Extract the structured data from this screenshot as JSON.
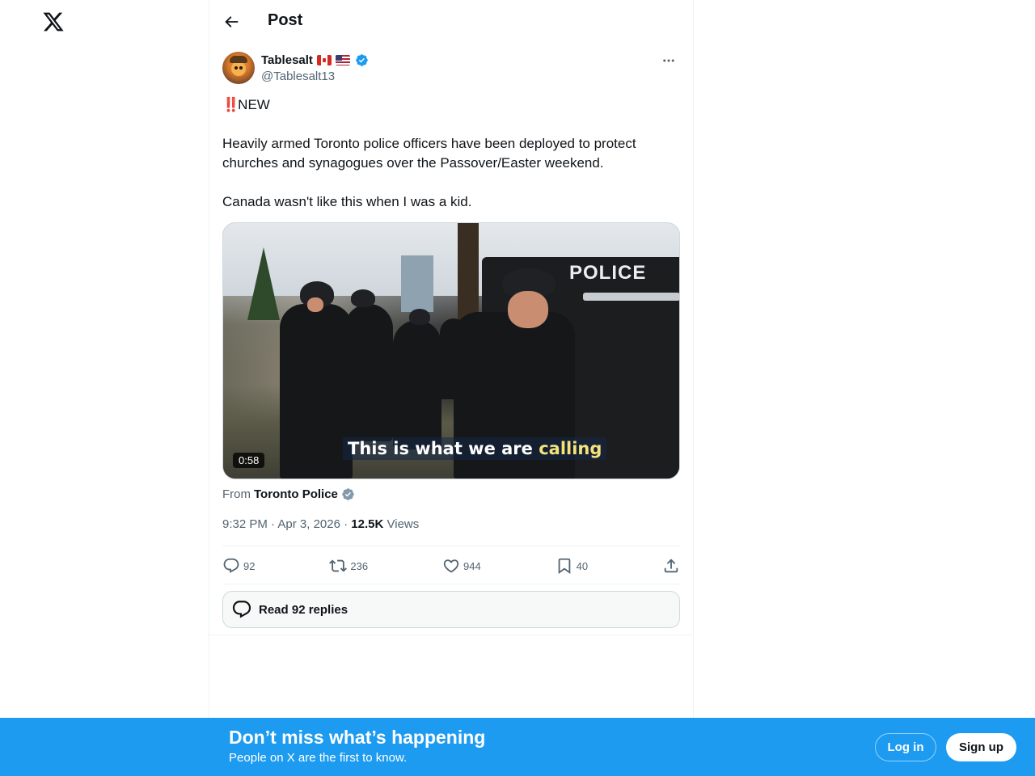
{
  "header": {
    "title": "Post"
  },
  "author": {
    "display_name": "Tablesalt",
    "handle": "@Tablesalt13",
    "flags": [
      "canada-flag-icon",
      "usa-flag-icon"
    ],
    "verified": true
  },
  "tweet": {
    "bang": "‼️",
    "line1": "NEW",
    "body": "Heavily armed Toronto police officers have been deployed to protect churches and synagogues over the Passover/Easter weekend.",
    "closing": "Canada wasn't like this when I was a kid."
  },
  "media": {
    "caption_start": "This is what we are ",
    "caption_highlight": "calling",
    "vehicle_label": "POLICE",
    "duration": "0:58"
  },
  "source": {
    "prefix": "From",
    "name": "Toronto Police"
  },
  "meta": {
    "time": "9:32 PM",
    "separator": "·",
    "date": "Apr 3, 2026",
    "views_count": "12.5K",
    "views_label": "Views"
  },
  "actions": {
    "replies": "92",
    "reposts": "236",
    "likes": "944",
    "bookmarks": "40"
  },
  "read_replies": {
    "label": "Read 92 replies"
  },
  "bottom_bar": {
    "title": "Don’t miss what’s happening",
    "subtitle": "People on X are the first to know.",
    "login": "Log in",
    "signup": "Sign up"
  },
  "colors": {
    "accent": "#1d9bf0",
    "text": "#0f1419",
    "secondary": "#536471",
    "border": "#eff3f4"
  }
}
